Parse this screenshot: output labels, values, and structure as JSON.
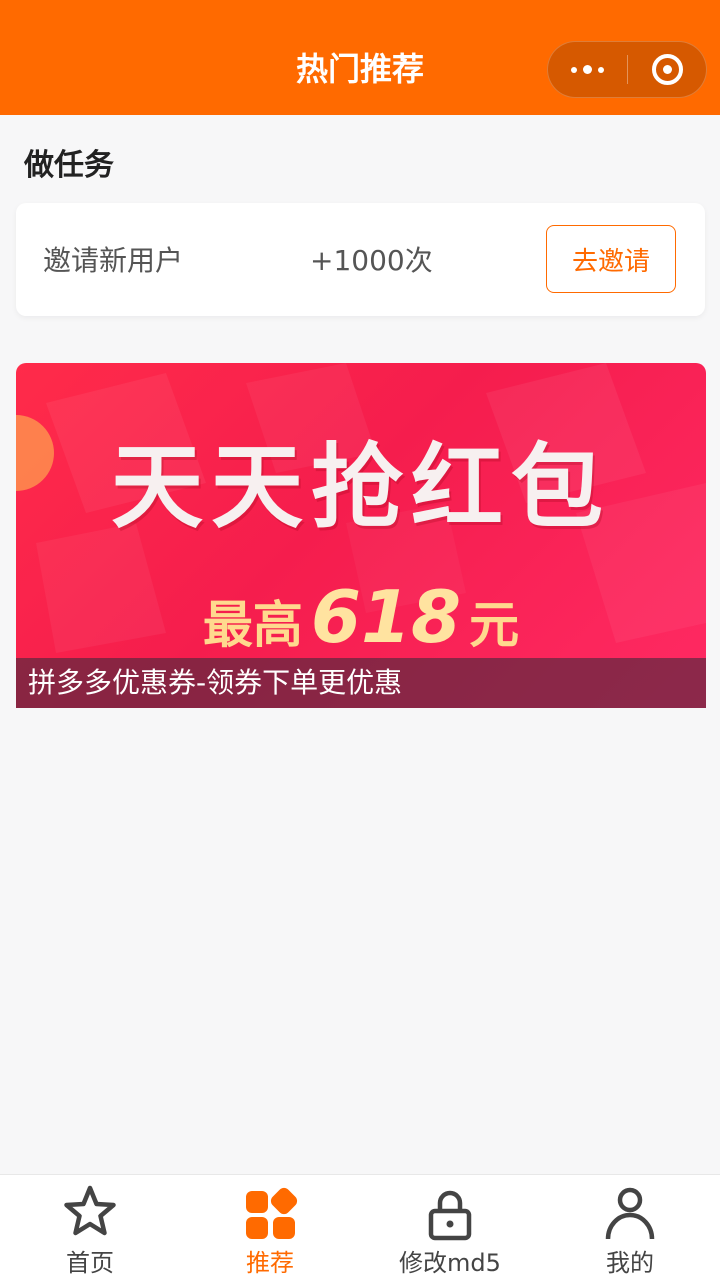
{
  "header": {
    "title": "热门推荐",
    "capsule": {
      "more_icon": "more-dots-icon",
      "close_icon": "target-close-icon"
    },
    "color": "#ff6a00"
  },
  "tasks": {
    "section_title": "做任务",
    "items": [
      {
        "name": "邀请新用户",
        "reward": "+1000次",
        "button": "去邀请"
      }
    ]
  },
  "banner": {
    "headline": "天天抢红包",
    "sub_prefix": "最高",
    "sub_amount": "618",
    "sub_suffix": "元",
    "caption": "拼多多优惠券-领券下单更优惠"
  },
  "tabbar": {
    "active_color": "#ff6a00",
    "items": [
      {
        "label": "首页",
        "icon": "star-icon",
        "active": false
      },
      {
        "label": "推荐",
        "icon": "grid-icon",
        "active": true
      },
      {
        "label": "修改md5",
        "icon": "lock-icon",
        "active": false
      },
      {
        "label": "我的",
        "icon": "user-icon",
        "active": false
      }
    ]
  }
}
